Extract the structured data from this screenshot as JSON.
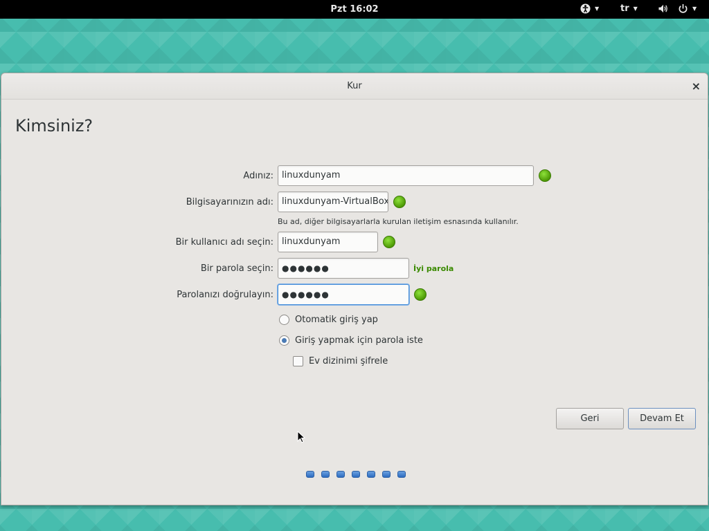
{
  "topbar": {
    "clock": "Pzt 16:02",
    "lang": "tr"
  },
  "window": {
    "title": "Kur",
    "close": "×"
  },
  "page": {
    "heading": "Kimsiniz?"
  },
  "form": {
    "name_label": "Adınız:",
    "name_value": "linuxdunyam",
    "computer_label": "Bilgisayarınızın adı:",
    "computer_value": "linuxdunyam-VirtualBox",
    "computer_hint": "Bu ad, diğer bilgisayarlarla kurulan iletişim esnasında kullanılır.",
    "username_label": "Bir kullanıcı adı seçin:",
    "username_value": "linuxdunyam",
    "password_label": "Bir parola seçin:",
    "password_value": "●●●●●●",
    "password_strength": "İyi parola",
    "confirm_label": "Parolanızı doğrulayın:",
    "confirm_value": "●●●●●●",
    "auto_login_label": "Otomatik giriş yap",
    "require_password_label": "Giriş yapmak için parola iste",
    "encrypt_home_label": "Ev dizinimi şifrele",
    "login_mode": "require_password",
    "encrypt_home": false
  },
  "buttons": {
    "back": "Geri",
    "continue": "Devam Et"
  },
  "progress": {
    "steps": 7,
    "current": 7
  },
  "colors": {
    "ok": "#4e9a06",
    "focus": "#4a90d9",
    "strength": "#3a8a00"
  }
}
